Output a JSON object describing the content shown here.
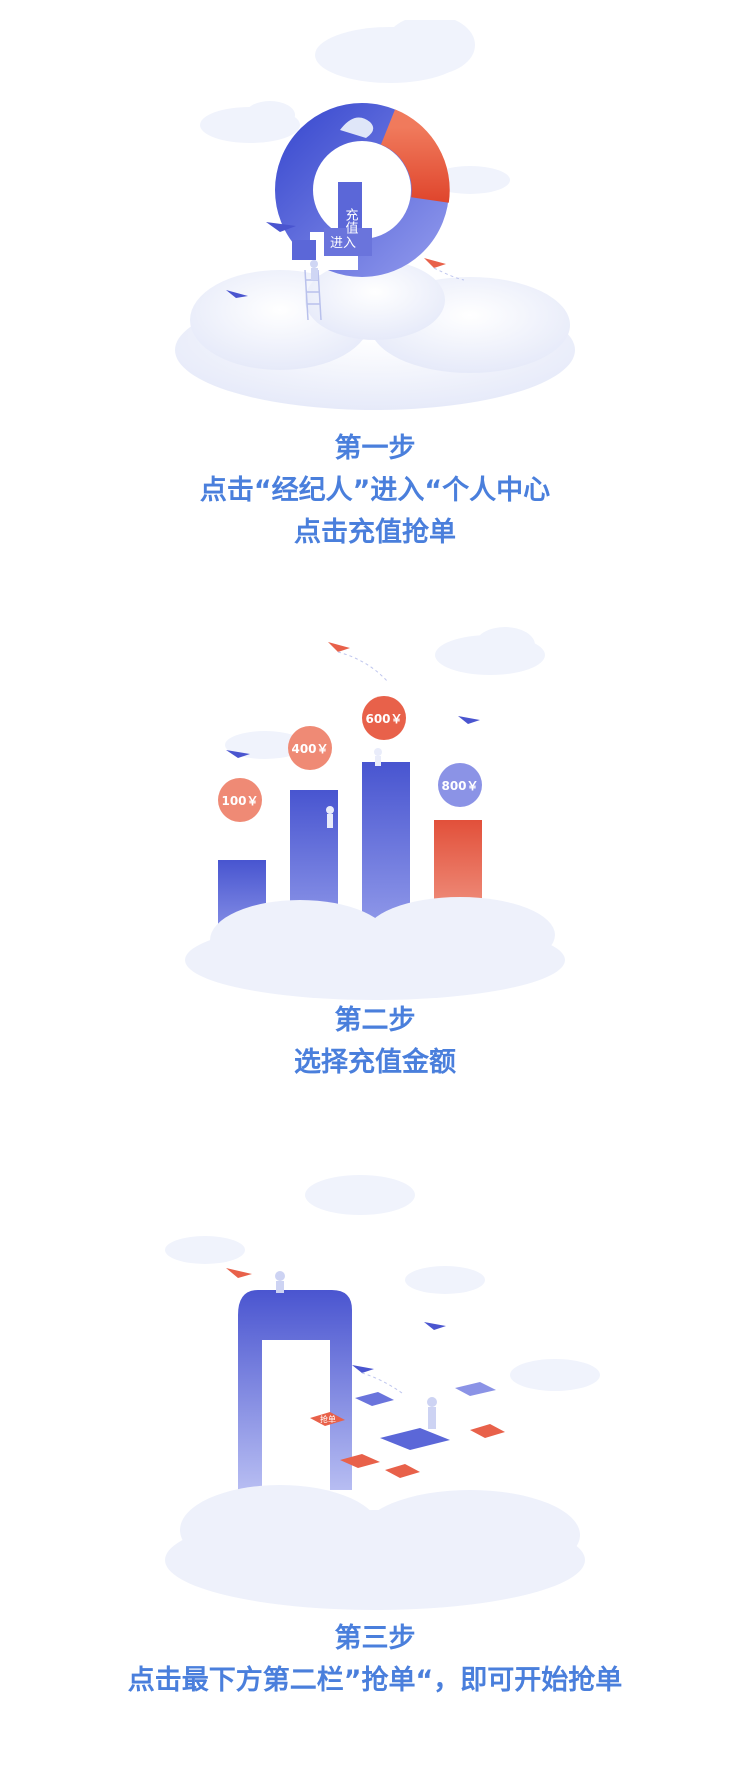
{
  "colors": {
    "accent_text": "#4a7fdc",
    "primary_blue": "#5b67d8",
    "secondary_red": "#e8614a",
    "cloud": "#eef1fb"
  },
  "step1": {
    "ring_labels": {
      "recharge": "充值",
      "enter": "进入"
    },
    "lines": [
      "第一步",
      "点击“经纪人”进入“个人中心",
      "点击充值抢单"
    ]
  },
  "step2": {
    "bubbles": [
      "100￥",
      "400￥",
      "600￥",
      "800￥"
    ],
    "lines": [
      "第二步",
      "选择充值金额"
    ]
  },
  "step3": {
    "tile_label": "抢单",
    "lines": [
      "第三步",
      "点击最下方第二栏”抢单“，即可开始抢单"
    ]
  },
  "icons": [
    "paper-plane-icon",
    "cloud-icon",
    "person-icon",
    "ladder-icon",
    "phone-icon"
  ]
}
